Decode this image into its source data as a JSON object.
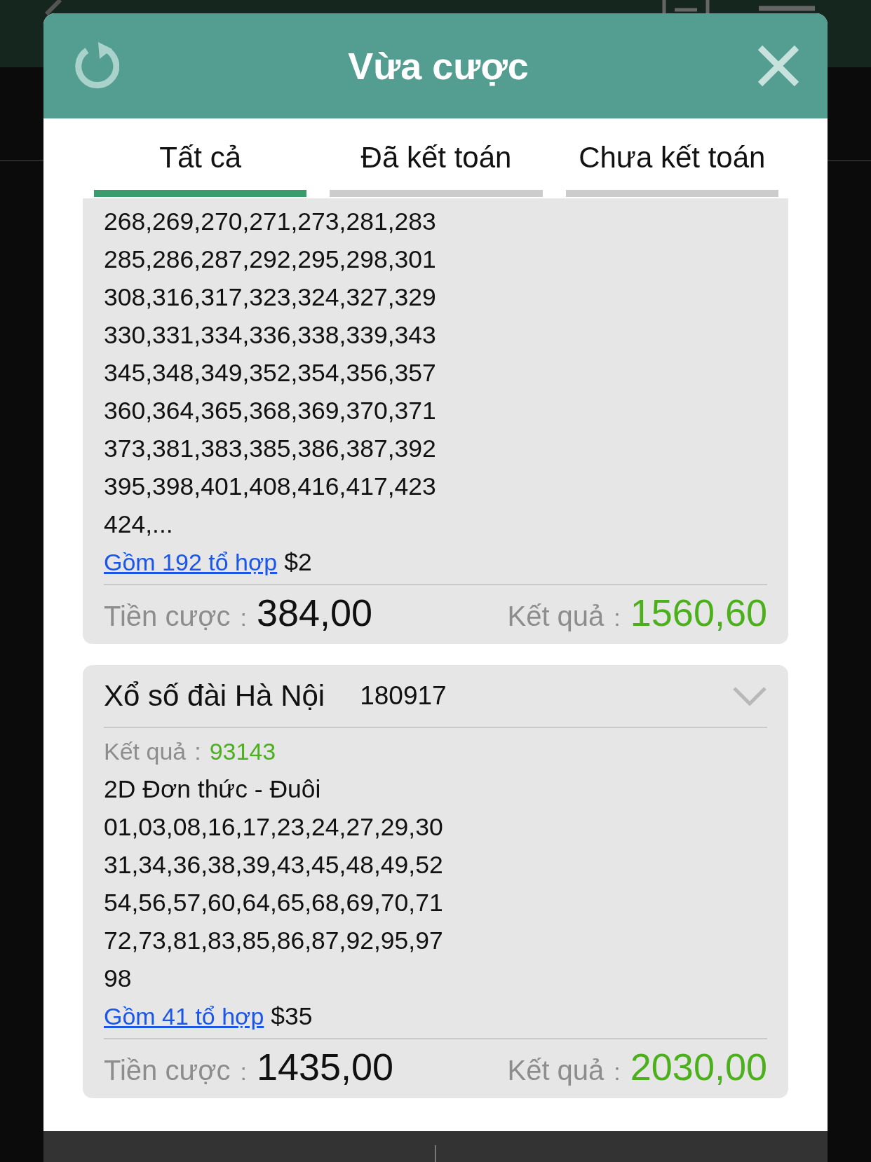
{
  "dialog": {
    "title": "Vừa cược"
  },
  "tabs": [
    {
      "label": "Tất cả",
      "selected": true
    },
    {
      "label": "Đã kết toán",
      "selected": false
    },
    {
      "label": "Chưa kết toán",
      "selected": false
    }
  ],
  "bets": [
    {
      "numbers": [
        "268,269,270,271,273,281,283",
        "285,286,287,292,295,298,301",
        "308,316,317,323,324,327,329",
        "330,331,334,336,338,339,343",
        "345,348,349,352,354,356,357",
        "360,364,365,368,369,370,371",
        "373,381,383,385,386,387,392",
        "395,398,401,408,416,417,423",
        "424,..."
      ],
      "combo_link": "Gồm 192 tổ hợp",
      "unit": "$2",
      "stake_label": "Tiền cược",
      "stake": "384,00",
      "payout_label": "Kết quả",
      "payout": "1560,60",
      "colon": ":"
    },
    {
      "lottery": "Xổ số đài Hà Nội",
      "draw": "180917",
      "result_label": "Kết quả",
      "result": "93143",
      "bet_type": "2D Đơn thức - Đuôi",
      "numbers": [
        "01,03,08,16,17,23,24,27,29,30",
        "31,34,36,38,39,43,45,48,49,52",
        "54,56,57,60,64,65,68,69,70,71",
        "72,73,81,83,85,86,87,92,95,97",
        "98"
      ],
      "combo_link": "Gồm 41 tổ hợp",
      "unit": "$35",
      "stake_label": "Tiền cược",
      "stake": "1435,00",
      "payout_label": "Kết quả",
      "payout": "2030,00",
      "colon": ":"
    }
  ]
}
